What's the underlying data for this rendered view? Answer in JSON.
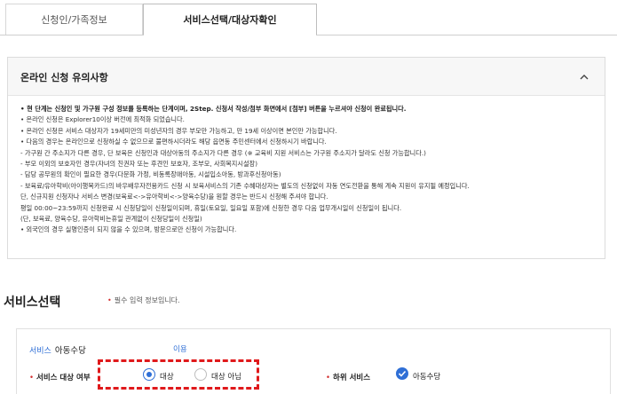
{
  "tabs": {
    "applicant_family": "신청인/가족정보",
    "service_select": "서비스선택/대상자확인"
  },
  "notice": {
    "title": "온라인 신청 유의사항",
    "lines": [
      "• 현 단계는 신청인 및 가구원 구성 정보를 등록하는 단계이며, 2Step. 신청서 작성/첨부 화면에서 [첨부] 버튼을 누르셔야 신청이 완료됩니다.",
      "• 온라인 신청은 Explorer10이상 버전에 최적화 되었습니다.",
      "• 온라인 신청은 서비스 대상자가 19세미만의 미성년자의 경우 부모만 가능하고, 만 19세 이상이면 본인만 가능합니다.",
      "• 다음의 경우는 온라인으로 신청하실 수 없으므로 불편하시더라도 해당 읍면동 주민센터에서 신청하시기 바랍니다.",
      "  - 가구원 간 주소지가 다른 경우, 단 보육은 신청인과 대상아동의 주소지가 다른 경우 (※ 교육비 지원 서비스는 가구원 주소지가 달라도 신청 가능합니다.)",
      "  - 부모 이외의 보호자인 경우(자녀의 친권자 또는 후견인 보호자, 조부모, 사회복지시설장)",
      "  - 담당 공무원의 확인이 필요한 경우(다문화 가정, 비동록장애아동, 시설입소아동, 방과후신청아동)",
      "  - 보육료/유아학비(아이행복카드)의 바우배우자전용카드 신청 시 보육서비스의 기존 수혜대상자는 별도의 신청없이 자동 연도전환을 통해 계속 지원이 유지될 예정입니다.",
      "    단, 신규지원 신청자나 서비스 변경(보육료<->유아학비<->양육수당)을 원할 경우는 반드시 신청해 주셔야 합니다.",
      "    평일 00:00~23:59까지 신청완료 시 신청당일이 신청일이되며, 휴일(토요일, 일요일 포함)에 신청한 경우 다음 업무개시일이 신청일이 됩니다.",
      "    (단, 보육료, 양육수당, 유아학비는휴일 관계없이 신청당일이 신청일)",
      "• 외국인의 경우 실명인증이 되지 않을 수 있으며, 방문으로만 신청이 가능합니다."
    ]
  },
  "service": {
    "title": "서비스선택",
    "required_star": "•",
    "required_note": "필수 입력 정보입니다.",
    "label_prefix": "서비스",
    "label_name": "아동수당",
    "link": "이용",
    "target_label": "서비스 대상 여부",
    "radio_yes": "대상",
    "radio_no": "대상 아님",
    "sub_label": "하위 서비스",
    "sub_value": "아동수당"
  },
  "colors": {
    "accent": "#2f6fd6",
    "required": "#d32f2f",
    "highlight": "#e0191b"
  }
}
